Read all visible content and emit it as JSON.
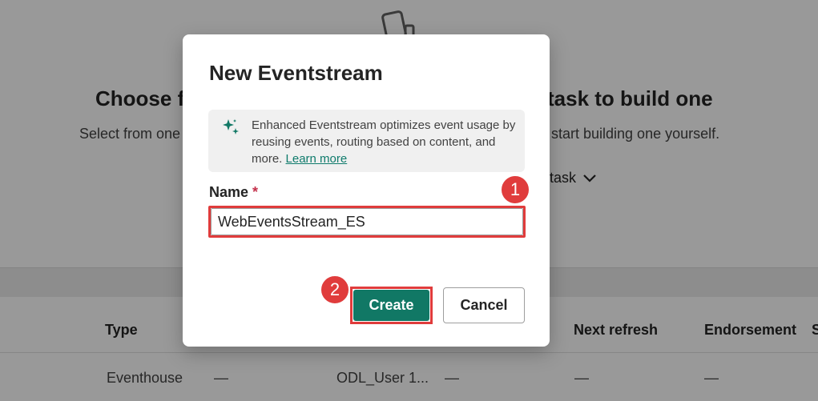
{
  "background": {
    "heading_left": "Choose f",
    "heading_right": "task to build one",
    "subtitle_left": "Select from one",
    "subtitle_right": "start building one yourself.",
    "task_button": "task",
    "table": {
      "headers": [
        "Type",
        "Next refresh",
        "Endorsement",
        "S"
      ],
      "row": [
        "Eventhouse",
        "—",
        "ODL_User 1...",
        "—",
        "—",
        "—"
      ]
    }
  },
  "dialog": {
    "title": "New Eventstream",
    "info_text": "Enhanced Eventstream optimizes event usage by reusing events, routing based on content, and more.",
    "info_link": "Learn more",
    "name_label": "Name",
    "required_mark": "*",
    "name_value": "WebEventsStream_ES",
    "create_label": "Create",
    "cancel_label": "Cancel"
  },
  "callouts": [
    "1",
    "2"
  ],
  "colors": {
    "accent": "#117865",
    "callout": "#e03c3c",
    "link": "#0f7b6c"
  }
}
